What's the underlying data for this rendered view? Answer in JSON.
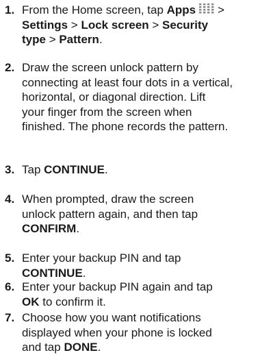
{
  "steps": [
    {
      "number": "1.",
      "lines": [
        {
          "segments": [
            {
              "t": "From the Home screen, tap ",
              "bold": false
            },
            {
              "t": "Apps",
              "bold": true
            },
            {
              "t": "__icon__",
              "icon": "apps-grid-icon"
            },
            {
              "t": ">",
              "bold": false
            }
          ]
        },
        {
          "segments": [
            {
              "t": "Settings",
              "bold": true
            },
            {
              "t": " > ",
              "bold": false
            },
            {
              "t": "Lock screen",
              "bold": true
            },
            {
              "t": " > ",
              "bold": false
            },
            {
              "t": "Security",
              "bold": true
            }
          ]
        },
        {
          "segments": [
            {
              "t": "type",
              "bold": true
            },
            {
              "t": " > ",
              "bold": false
            },
            {
              "t": "Pattern",
              "bold": true
            },
            {
              "t": ".",
              "bold": false
            }
          ]
        }
      ]
    },
    {
      "number": "2.",
      "lines": [
        {
          "segments": [
            {
              "t": "Draw the screen unlock pattern by",
              "bold": false
            }
          ]
        },
        {
          "segments": [
            {
              "t": "connecting at least four dots in a vertical,",
              "bold": false
            }
          ]
        },
        {
          "segments": [
            {
              "t": "horizontal, or diagonal direction. Lift",
              "bold": false
            }
          ]
        },
        {
          "segments": [
            {
              "t": "your finger from the screen when",
              "bold": false
            }
          ]
        },
        {
          "segments": [
            {
              "t": "finished. The phone records the pattern.",
              "bold": false
            }
          ]
        }
      ]
    },
    {
      "number": "3.",
      "lines": [
        {
          "segments": [
            {
              "t": "Tap ",
              "bold": false
            },
            {
              "t": "CONTINUE",
              "bold": true
            },
            {
              "t": ".",
              "bold": false
            }
          ]
        }
      ]
    },
    {
      "number": "4.",
      "lines": [
        {
          "segments": [
            {
              "t": "When prompted, draw the screen",
              "bold": false
            }
          ]
        },
        {
          "segments": [
            {
              "t": "unlock pattern again, and then tap",
              "bold": false
            }
          ]
        },
        {
          "segments": [
            {
              "t": "CONFIRM",
              "bold": true
            },
            {
              "t": ".",
              "bold": false
            }
          ]
        }
      ]
    },
    {
      "number": "5.",
      "lines": [
        {
          "segments": [
            {
              "t": "Enter your backup PIN and tap",
              "bold": false
            }
          ]
        },
        {
          "segments": [
            {
              "t": "CONTINUE",
              "bold": true
            },
            {
              "t": ".",
              "bold": false
            }
          ]
        }
      ]
    },
    {
      "number": "6.",
      "lines": [
        {
          "segments": [
            {
              "t": "Enter your backup PIN again and tap",
              "bold": false
            }
          ]
        },
        {
          "segments": [
            {
              "t": "OK",
              "bold": true
            },
            {
              "t": " to confirm it.",
              "bold": false
            }
          ]
        }
      ]
    },
    {
      "number": "7.",
      "lines": [
        {
          "segments": [
            {
              "t": "Choose how you want notifications",
              "bold": false
            }
          ]
        },
        {
          "segments": [
            {
              "t": "displayed when your phone is locked",
              "bold": false
            }
          ]
        },
        {
          "segments": [
            {
              "t": "and tap ",
              "bold": false
            },
            {
              "t": "DONE",
              "bold": true
            },
            {
              "t": ".",
              "bold": false
            }
          ]
        }
      ]
    }
  ],
  "colors": {
    "text": "#1a1a1a",
    "icon_dots": "#8a8a8a",
    "background": "#ffffff"
  }
}
